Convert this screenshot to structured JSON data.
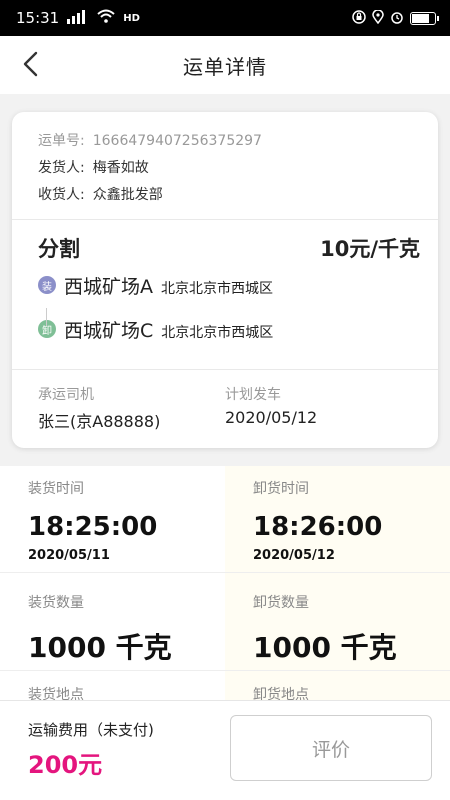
{
  "status_bar": {
    "time": "15:31",
    "network": "4G",
    "wifi_badge": "HD",
    "right_icons": [
      "lock-icon",
      "location-icon",
      "alarm-icon",
      "battery-icon"
    ],
    "battery_level": 0.8
  },
  "header": {
    "title": "运单详情",
    "back_icon": "chevron-left-icon"
  },
  "waybill": {
    "number_label": "运单号:",
    "number": "1666479407256375297",
    "shipper_label": "发货人:",
    "shipper": "梅香如故",
    "consignee_label": "收货人:",
    "consignee": "众鑫批发部"
  },
  "goods": {
    "name": "分割",
    "price": "10元/千克",
    "load_badge": "装",
    "load_place": "西城矿场A",
    "load_address": "北京北京市西城区",
    "unload_badge": "卸",
    "unload_place": "西城矿场C",
    "unload_address": "北京北京市西城区"
  },
  "carrier": {
    "driver_label": "承运司机",
    "driver": "张三(京A88888)",
    "plan_label": "计划发车",
    "plan_date": "2020/05/12"
  },
  "times": {
    "load_time_label": "装货时间",
    "load_time": "18:25:00",
    "load_date": "2020/05/11",
    "unload_time_label": "卸货时间",
    "unload_time": "18:26:00",
    "unload_date": "2020/05/12"
  },
  "quantities": {
    "load_qty_label": "装货数量",
    "load_qty": "1000 千克",
    "unload_qty_label": "卸货数量",
    "unload_qty": "1000 千克"
  },
  "places_partial": {
    "load_place_label": "装货地点",
    "unload_place_label": "卸货地点"
  },
  "footer": {
    "fee_label": "运输费用（未支付)",
    "fee_amount": "200元",
    "review_button": "评价"
  },
  "colors": {
    "accent_pink": "#e4157e",
    "load_badge": "#8b8fc9",
    "unload_badge": "#7fbf96"
  }
}
